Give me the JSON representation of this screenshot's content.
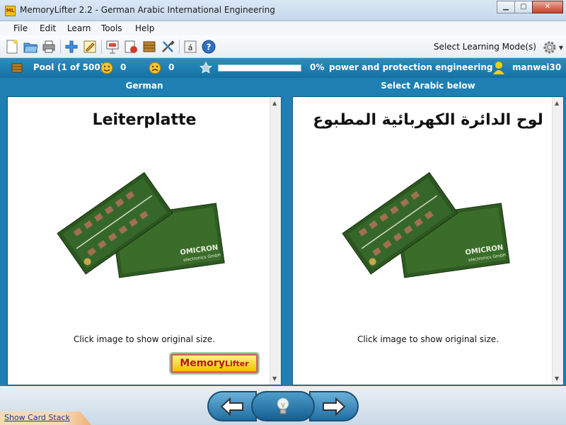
{
  "window": {
    "title": "MemoryLifter 2.2 - German Arabic International Engineering",
    "icon_label": "ML",
    "buttons": [
      "minimize",
      "maximize",
      "close"
    ]
  },
  "menu": {
    "items": [
      "File",
      "Edit",
      "Learn",
      "Tools",
      "Help"
    ]
  },
  "toolbar": {
    "icons": [
      "new-file-icon",
      "open-folder-icon",
      "print-icon",
      "add-card-icon",
      "edit-card-icon",
      "presentation-icon",
      "print-cards-icon",
      "card-box-icon",
      "tools-icon",
      "character-map-icon",
      "help-icon"
    ],
    "character_button_label": "á",
    "mode_label": "Select Learning Mode(s)"
  },
  "status": {
    "pool_label": "Pool",
    "pool_count": "(1 of 500)",
    "correct_count": "0",
    "wrong_count": "0",
    "progress_percent": "0%",
    "progress_fraction": 0.0,
    "chapter": "power and protection engineering",
    "user": "manwei30"
  },
  "question": {
    "column_header": "German",
    "word": "Leiterplatte",
    "caption": "Click image to show original size.",
    "logo_text": "MemoryLifter"
  },
  "answer": {
    "column_header": "Select Arabic below",
    "word": "لوح الدائرة الكهربائية المطبوع",
    "caption": "Click image to show original size."
  },
  "board_label": "OMICRON",
  "board_sublabel": "electronics GmbH",
  "footer": {
    "show_stack": "Show Card Stack"
  },
  "colors": {
    "main_bg": "#1d7fb2",
    "status_bg": "#1570a3",
    "panel_bg": "#ffffff"
  }
}
